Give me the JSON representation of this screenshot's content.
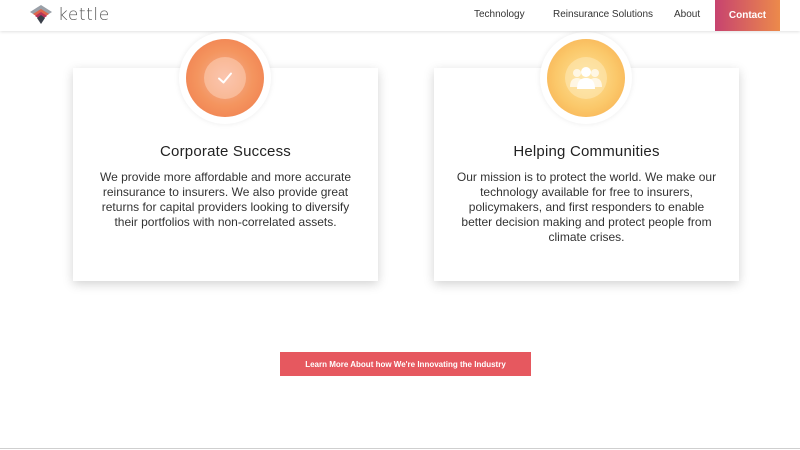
{
  "header": {
    "logo_text": "kettle",
    "nav": {
      "technology": "Technology",
      "reinsurance": "Reinsurance Solutions",
      "about": "About",
      "contact": "Contact"
    }
  },
  "cards": [
    {
      "icon": "checkmark-icon",
      "title": "Corporate Success",
      "body": "We provide more affordable and more accurate reinsurance to insurers. We also provide great returns for capital providers looking to diversify their portfolios with non-correlated assets."
    },
    {
      "icon": "people-icon",
      "title": "Helping Communities",
      "body": "Our mission is to protect the world. We make our technology available for free to insurers, policymakers, and first responders to enable better decision making and protect people from climate crises."
    }
  ],
  "cta": {
    "label": "Learn More About how We're Innovating the Industry"
  },
  "colors": {
    "contact_gradient_start": "#c7436f",
    "contact_gradient_end": "#ec8a4b",
    "cta_bg": "#e6585f",
    "orange_icon": "#f0784a",
    "yellow_icon": "#fbc86a"
  }
}
